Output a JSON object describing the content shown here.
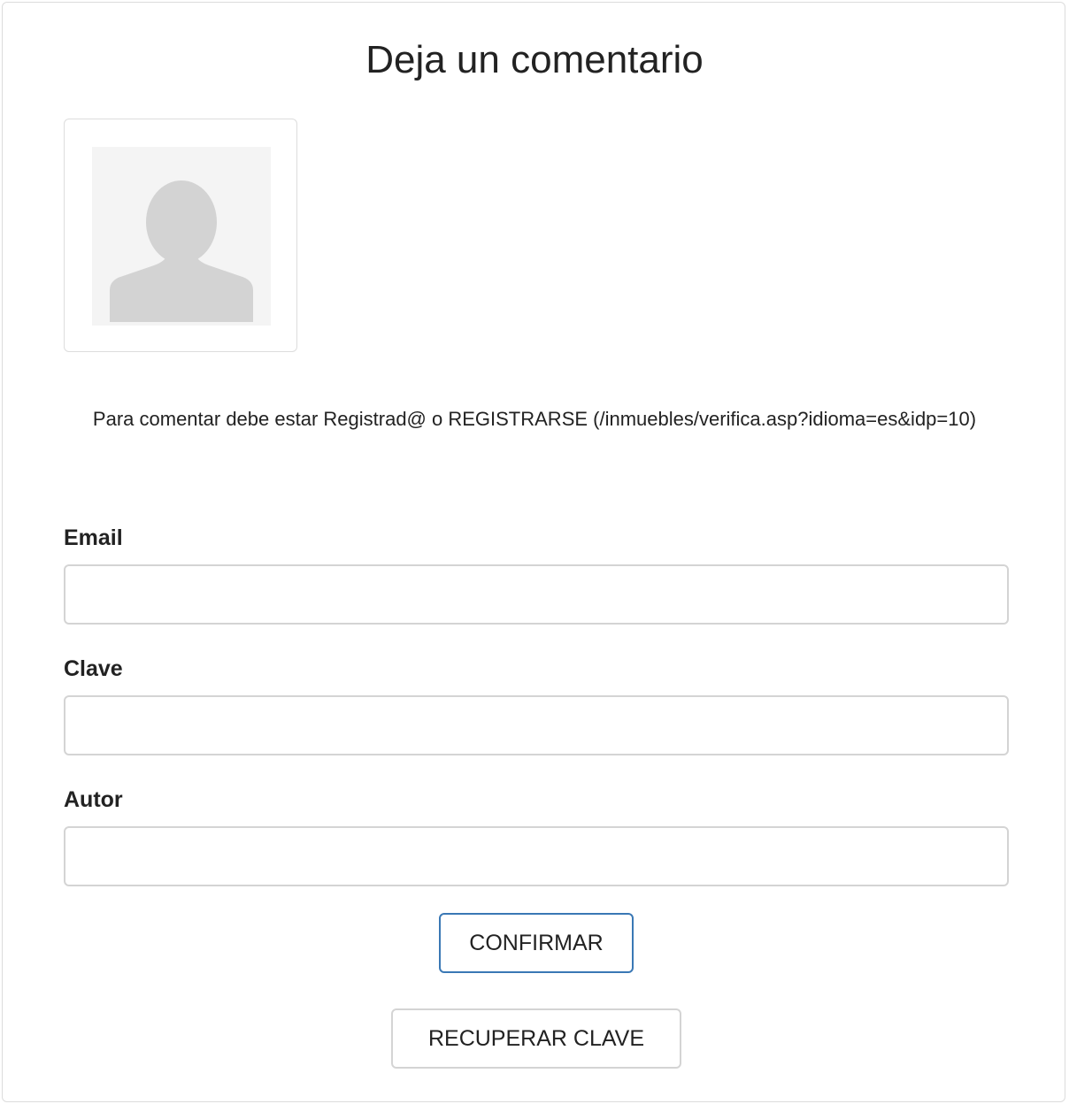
{
  "form": {
    "title": "Deja un comentario",
    "notice_text": "Para comentar debe estar Registrad@ o REGISTRARSE (/inmuebles/verifica.asp?idioma=es&idp=10)",
    "avatar_icon": "user-silhouette-icon",
    "fields": {
      "email": {
        "label": "Email",
        "value": "",
        "placeholder": ""
      },
      "clave": {
        "label": "Clave",
        "value": "",
        "placeholder": ""
      },
      "autor": {
        "label": "Autor",
        "value": "",
        "placeholder": ""
      }
    },
    "buttons": {
      "confirm_label": "CONFIRMAR",
      "recover_label": "RECUPERAR CLAVE"
    },
    "colors": {
      "confirm_border": "#3a78b5",
      "field_border": "#d4d4d4",
      "avatar_fill": "#d3d3d3",
      "avatar_bg": "#f4f4f4"
    }
  }
}
